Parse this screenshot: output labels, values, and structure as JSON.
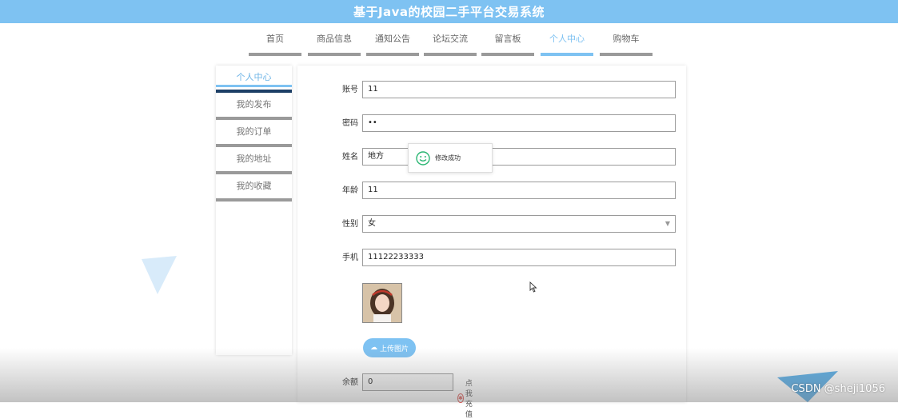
{
  "header": {
    "title": "基于Java的校园二手平台交易系统"
  },
  "nav": {
    "items": [
      {
        "label": "首页"
      },
      {
        "label": "商品信息"
      },
      {
        "label": "通知公告"
      },
      {
        "label": "论坛交流"
      },
      {
        "label": "留言板"
      },
      {
        "label": "个人中心"
      },
      {
        "label": "购物车"
      }
    ],
    "active_index": 5
  },
  "sidebar": {
    "items": [
      {
        "label": "个人中心"
      },
      {
        "label": "我的发布"
      },
      {
        "label": "我的订单"
      },
      {
        "label": "我的地址"
      },
      {
        "label": "我的收藏"
      }
    ]
  },
  "form": {
    "account": {
      "label": "账号",
      "value": "11"
    },
    "password": {
      "label": "密码",
      "value": "••"
    },
    "name": {
      "label": "姓名",
      "value": "地方"
    },
    "age": {
      "label": "年龄",
      "value": "11"
    },
    "gender": {
      "label": "性别",
      "value": "女"
    },
    "phone": {
      "label": "手机",
      "value": "11122233333"
    },
    "upload_label": "上传图片",
    "balance": {
      "label": "余额",
      "value": "0"
    },
    "recharge_label": "点我充值"
  },
  "toast": {
    "message": "修改成功"
  },
  "watermark": "CSDN @sheji1056",
  "colors": {
    "accent": "#7ec2f2",
    "nav_bar": "#9a9a9a",
    "sidebar_active_bar": "#1d3f66"
  }
}
